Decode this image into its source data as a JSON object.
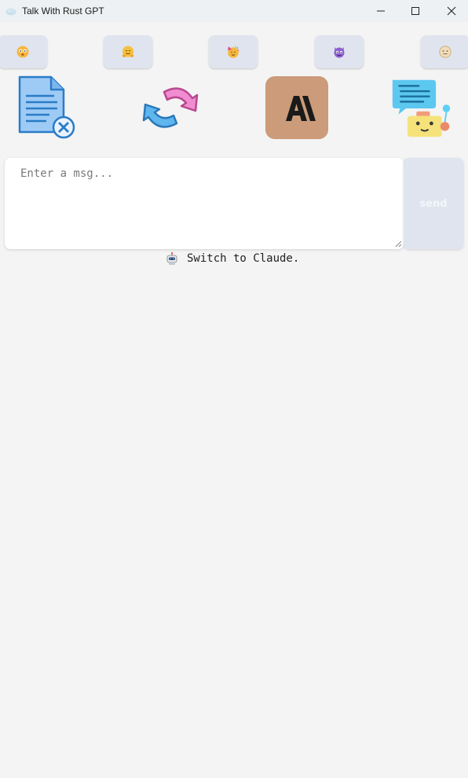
{
  "window": {
    "title": "Talk With Rust GPT"
  },
  "emoji_buttons": [
    {
      "icon": "confused-face-icon"
    },
    {
      "icon": "hugging-face-icon"
    },
    {
      "icon": "party-face-icon"
    },
    {
      "icon": "purple-devil-icon"
    },
    {
      "icon": "pale-face-icon"
    }
  ],
  "actions": [
    {
      "icon": "clear-document-icon"
    },
    {
      "icon": "refresh-icon"
    },
    {
      "icon": "anthropic-logo-icon",
      "logo_text": "A\\"
    },
    {
      "icon": "chat-bot-icon"
    }
  ],
  "composer": {
    "placeholder": "Enter a msg...",
    "value": "",
    "send_label": "send"
  },
  "status": {
    "icon": "robot-icon",
    "text": "Switch to Claude."
  },
  "colors": {
    "background": "#f4f4f4",
    "button_bg": "#dfe4ef",
    "anthropic_bg": "#cc9b7a"
  }
}
